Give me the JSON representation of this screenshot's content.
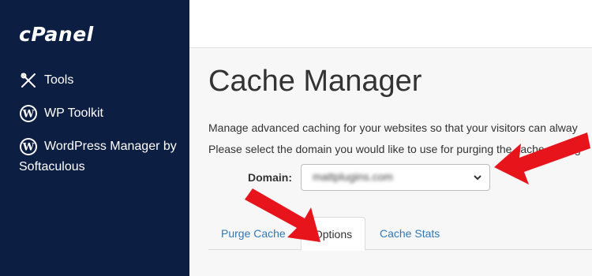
{
  "sidebar": {
    "logo": "cPanel",
    "items": [
      {
        "label": "Tools",
        "icon": "tools-icon"
      },
      {
        "label": "WP Toolkit",
        "icon": "wordpress-icon"
      },
      {
        "label": "WordPress Manager by Softaculous",
        "icon": "wordpress-icon"
      }
    ]
  },
  "main": {
    "title": "Cache Manager",
    "description_1": "Manage advanced caching for your websites so that your visitors can alway",
    "description_2": "Please select the domain you would like to use for purging the cache, chang",
    "domain_label": "Domain:",
    "domain_value": "mattplugins.com",
    "tabs": [
      {
        "label": "Purge Cache",
        "active": false
      },
      {
        "label": "Options",
        "active": true
      },
      {
        "label": "Cache Stats",
        "active": false
      }
    ]
  },
  "colors": {
    "sidebar_bg": "#0d1e43",
    "link": "#2f78b7",
    "annotation_arrow": "#e8141b"
  }
}
